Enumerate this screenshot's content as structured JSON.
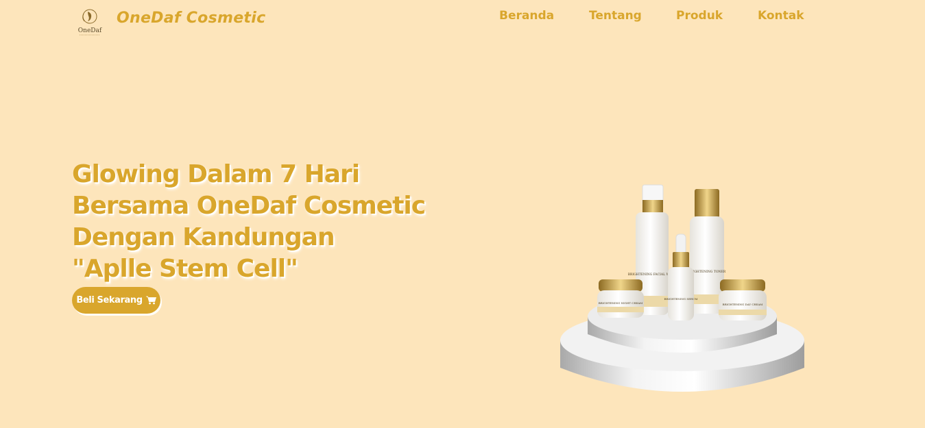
{
  "brand": {
    "name": "OneDaf Cosmetic",
    "logo_text": "OneDaf",
    "logo_icon": "face-silhouette-logo"
  },
  "nav": {
    "items": [
      {
        "label": "Beranda"
      },
      {
        "label": "Tentang"
      },
      {
        "label": "Produk"
      },
      {
        "label": "Kontak"
      }
    ]
  },
  "hero": {
    "title_lines": [
      "Glowing Dalam 7 Hari",
      "Bersama OneDaf Cosmetic",
      "Dengan Kandungan",
      "\"Aplle Stem Cell\""
    ],
    "cta_label": "Beli Sekarang",
    "cta_icon": "shopping-cart-icon",
    "product_labels": [
      "BRIGHTENING FACIAL WASH",
      "BRIGHTENING TONER",
      "BRIGHTENING SERUM",
      "BRIGHTENING NIGHT CREAM",
      "BRIGHTENING DAY CREAM"
    ]
  },
  "colors": {
    "background": "#fde5bb",
    "accent": "#d9a62c",
    "button_text": "#ffffff"
  }
}
